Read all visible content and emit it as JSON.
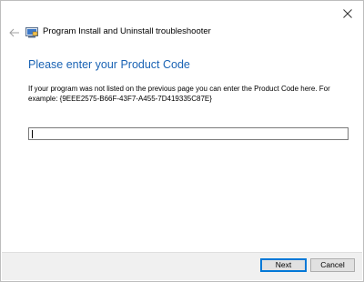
{
  "window": {
    "title": "Program Install and Uninstall troubleshooter"
  },
  "icons": {
    "close": "close-icon",
    "back": "back-arrow-icon",
    "app": "troubleshooter-app-icon"
  },
  "page": {
    "heading": "Please enter your Product Code",
    "description": "If your program was not listed on the previous page you can enter the Product Code here. For example: {9EEE2575-B66F-43F7-A455-7D419335C87E}"
  },
  "product_code_input": {
    "value": "",
    "placeholder": ""
  },
  "footer": {
    "next_label": "Next",
    "cancel_label": "Cancel"
  },
  "colors": {
    "heading": "#1a63b4",
    "footer_background": "#f0f0f0",
    "default_button_border": "#0078d7"
  }
}
